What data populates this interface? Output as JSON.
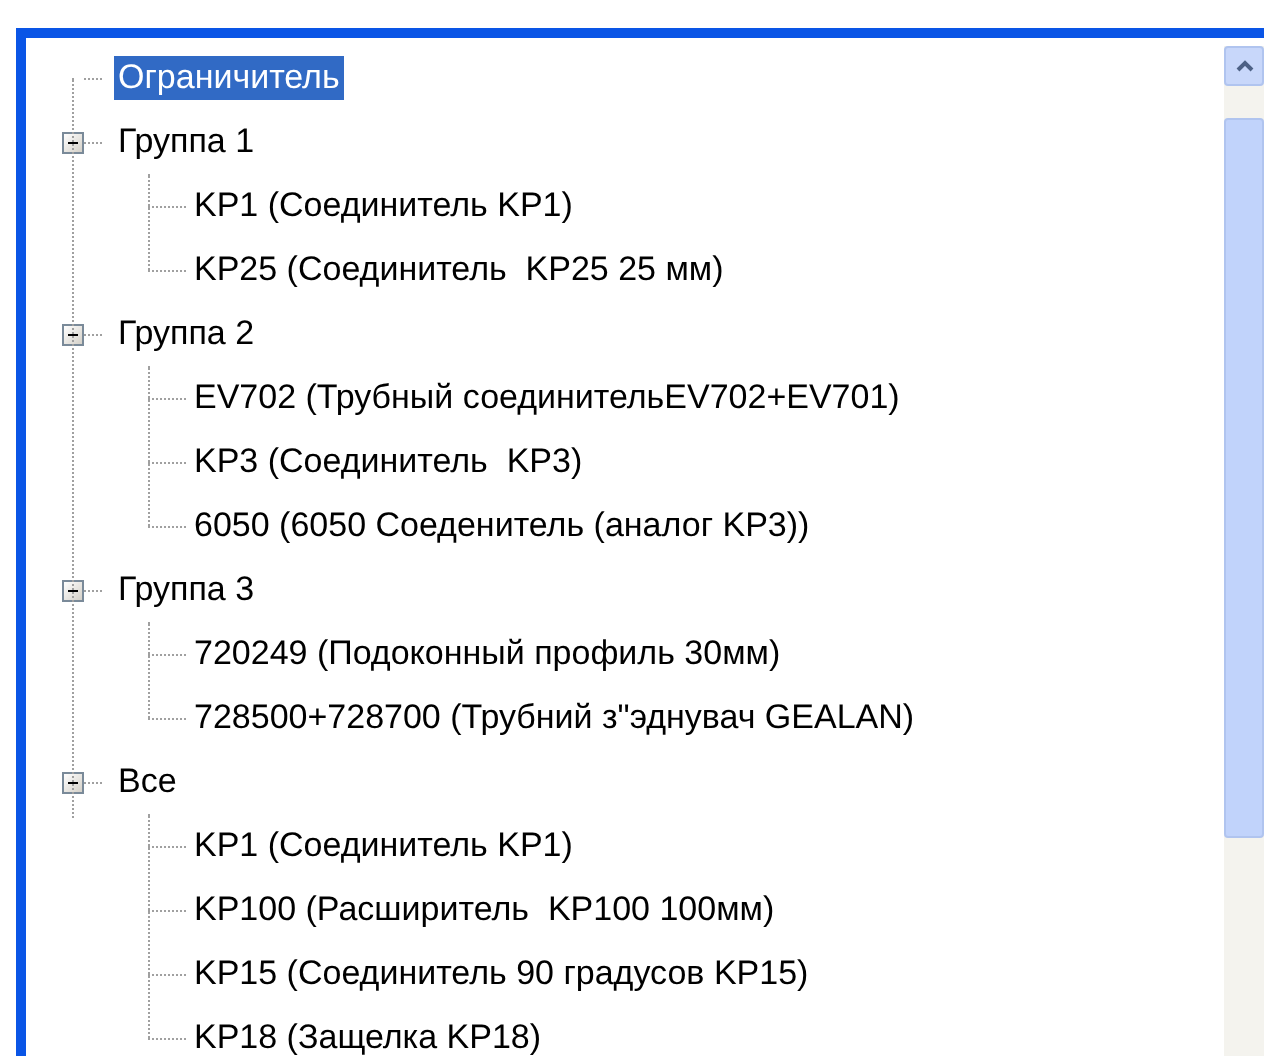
{
  "tree": {
    "items": [
      {
        "label": "Ограничитель",
        "selected": true
      },
      {
        "label": "Группа 1",
        "selected": false,
        "expanded": true,
        "children": [
          {
            "label": "KP1 (Соединитель KP1)",
            "selected": false
          },
          {
            "label": "KP25 (Соединитель  KP25 25 мм)",
            "selected": false
          }
        ]
      },
      {
        "label": "Группа 2",
        "selected": false,
        "expanded": true,
        "children": [
          {
            "label": "EV702 (Трубный соединительEV702+EV701)",
            "selected": false
          },
          {
            "label": "KP3 (Соединитель  KP3)",
            "selected": false
          },
          {
            "label": "6050 (6050 Соеденитель (аналог KP3))",
            "selected": false
          }
        ]
      },
      {
        "label": "Группа 3",
        "selected": false,
        "expanded": true,
        "children": [
          {
            "label": "720249 (Подоконный профиль 30мм)",
            "selected": false
          },
          {
            "label": "728500+728700 (Трубний з\"эднувач GEALAN)",
            "selected": false
          }
        ]
      },
      {
        "label": "Все",
        "selected": false,
        "expanded": true,
        "children": [
          {
            "label": "KP1 (Соединитель KP1)",
            "selected": false
          },
          {
            "label": "KP100 (Расширитель  KP100 100мм)",
            "selected": false
          },
          {
            "label": "KP15 (Соединитель 90 градусов KP15)",
            "selected": false
          },
          {
            "label": "KP18 (Защелка KP18)",
            "selected": false
          }
        ]
      }
    ]
  }
}
